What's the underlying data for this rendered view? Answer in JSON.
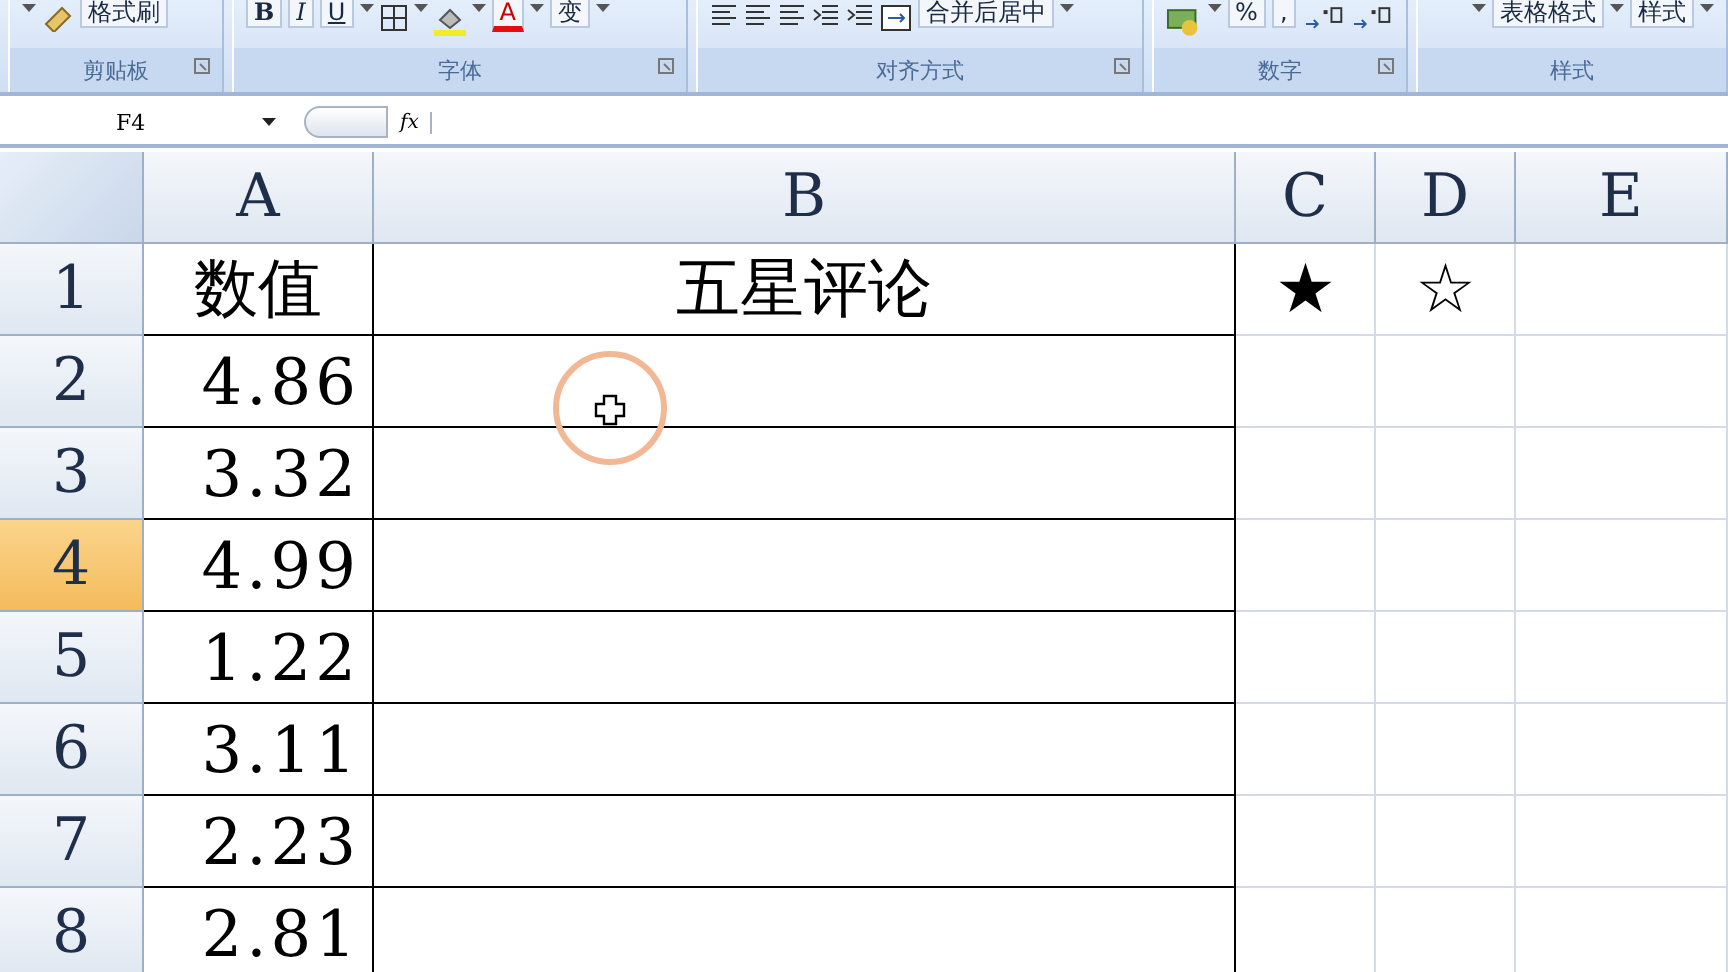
{
  "ribbon": {
    "groups": [
      {
        "label": "剪贴板",
        "controls": [
          {
            "kind": "caret"
          },
          {
            "kind": "brush",
            "text": "格式刷"
          }
        ]
      },
      {
        "label": "字体",
        "controls": [
          {
            "kind": "bold",
            "text": "B"
          },
          {
            "kind": "italic",
            "text": "I"
          },
          {
            "kind": "underline",
            "text": "U"
          },
          {
            "kind": "caret"
          },
          {
            "kind": "borders"
          },
          {
            "kind": "caret"
          },
          {
            "kind": "fill"
          },
          {
            "kind": "caret"
          },
          {
            "kind": "fontcolor",
            "text": "A"
          },
          {
            "kind": "caret"
          },
          {
            "kind": "plain",
            "text": "变"
          },
          {
            "kind": "caret"
          }
        ]
      },
      {
        "label": "对齐方式",
        "controls": [
          {
            "kind": "align"
          },
          {
            "kind": "align"
          },
          {
            "kind": "align"
          },
          {
            "kind": "indent"
          },
          {
            "kind": "indent"
          },
          {
            "kind": "merge",
            "text": "合并后居中"
          },
          {
            "kind": "caret"
          }
        ]
      },
      {
        "label": "数字",
        "controls": [
          {
            "kind": "money"
          },
          {
            "kind": "caret"
          },
          {
            "kind": "plain",
            "text": "%"
          },
          {
            "kind": "plain",
            "text": ","
          },
          {
            "kind": "decimal"
          },
          {
            "kind": "decimal"
          }
        ]
      },
      {
        "label": "样式",
        "controls": [
          {
            "kind": "caret"
          },
          {
            "kind": "plain",
            "text": "表格格式"
          },
          {
            "kind": "caret"
          },
          {
            "kind": "plain",
            "text": "样式"
          },
          {
            "kind": "caret"
          }
        ]
      }
    ]
  },
  "formula_bar": {
    "name_box": "F4",
    "fx": "fx"
  },
  "sheet": {
    "columns": [
      {
        "label": "A",
        "selected": false
      },
      {
        "label": "B",
        "selected": false
      },
      {
        "label": "C",
        "selected": false
      },
      {
        "label": "D",
        "selected": false
      },
      {
        "label": "E",
        "selected": false
      }
    ],
    "rows": [
      {
        "label": "1",
        "selected": false,
        "cells": [
          "数值",
          "五星评论",
          "★",
          "☆",
          ""
        ]
      },
      {
        "label": "2",
        "selected": false,
        "cells": [
          "4.86",
          "",
          "",
          "",
          ""
        ]
      },
      {
        "label": "3",
        "selected": false,
        "cells": [
          "3.32",
          "",
          "",
          "",
          ""
        ]
      },
      {
        "label": "4",
        "selected": true,
        "cells": [
          "4.99",
          "",
          "",
          "",
          ""
        ]
      },
      {
        "label": "5",
        "selected": false,
        "cells": [
          "1.22",
          "",
          "",
          "",
          ""
        ]
      },
      {
        "label": "6",
        "selected": false,
        "cells": [
          "3.11",
          "",
          "",
          "",
          ""
        ]
      },
      {
        "label": "7",
        "selected": false,
        "cells": [
          "2.23",
          "",
          "",
          "",
          ""
        ]
      },
      {
        "label": "8",
        "selected": false,
        "cells": [
          "2.81",
          "",
          "",
          "",
          ""
        ]
      }
    ]
  }
}
